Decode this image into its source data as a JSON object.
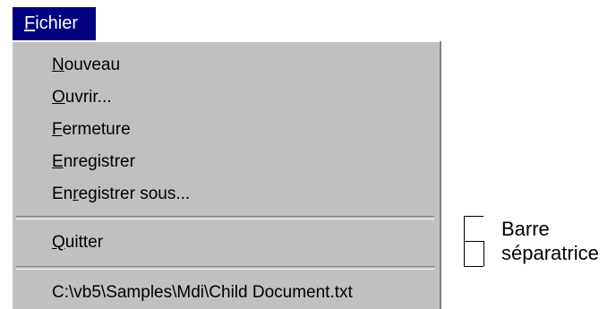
{
  "menubar": {
    "fichier": {
      "prefix": "",
      "accel": "F",
      "rest": "ichier"
    }
  },
  "menu": {
    "nouveau": {
      "prefix": "",
      "accel": "N",
      "rest": "ouveau"
    },
    "ouvrir": {
      "prefix": "",
      "accel": "O",
      "rest": "uvrir..."
    },
    "fermeture": {
      "prefix": "",
      "accel": "F",
      "rest": "ermeture"
    },
    "enregistrer": {
      "prefix": "",
      "accel": "E",
      "rest": "nregistrer"
    },
    "enregistrer_sous": {
      "prefix": "En",
      "accel": "r",
      "rest": "egistrer sous..."
    },
    "quitter": {
      "prefix": "",
      "accel": "Q",
      "rest": "uitter"
    },
    "recent_file": "C:\\vb5\\Samples\\Mdi\\Child Document.txt"
  },
  "annotation": {
    "line1": "Barre",
    "line2": "séparatrice"
  },
  "colors": {
    "menu_bg": "#c0c0c0",
    "highlight_bg": "#000080",
    "highlight_text": "#ffffff"
  }
}
